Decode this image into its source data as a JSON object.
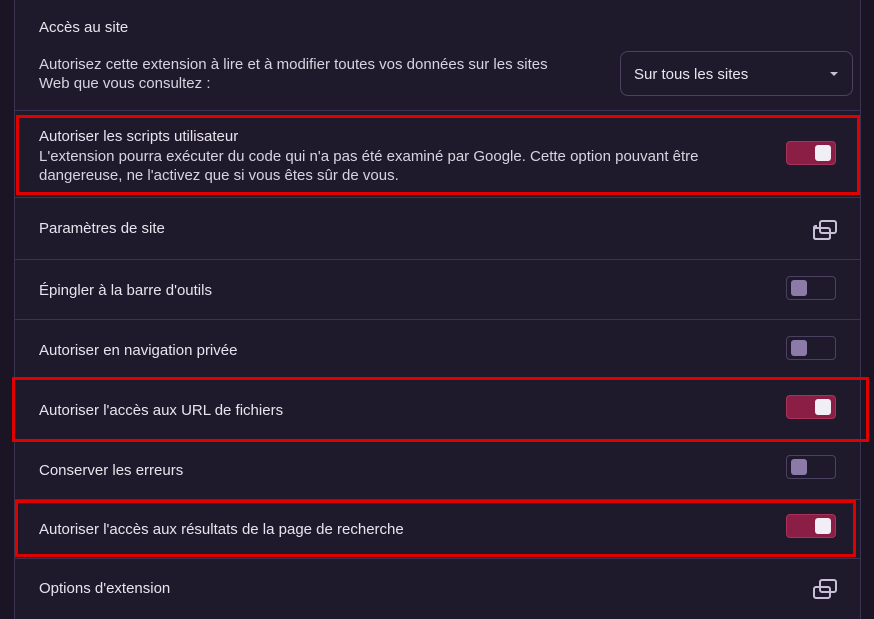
{
  "site_access": {
    "heading": "Accès au site",
    "description_line1": "Autorisez cette extension à lire et à modifier toutes vos données sur les sites",
    "description_line2": "Web que vous consultez :",
    "select_value": "Sur tous les sites"
  },
  "user_scripts": {
    "label": "Autoriser les scripts utilisateur",
    "description_line1": "L'extension pourra exécuter du code qui n'a pas été examiné par Google. Cette option pouvant être",
    "description_line2": "dangereuse, ne l'activez que si vous êtes sûr de vous.",
    "enabled": true
  },
  "site_settings": {
    "label": "Paramètres de site",
    "icon": "open-in-new-window-icon"
  },
  "pin_toolbar": {
    "label": "Épingler à la barre d'outils",
    "enabled": false
  },
  "incognito": {
    "label": "Autoriser en navigation privée",
    "enabled": false
  },
  "file_urls": {
    "label": "Autoriser l'accès aux URL de fichiers",
    "enabled": true
  },
  "collect_errors": {
    "label": "Conserver les erreurs",
    "enabled": false
  },
  "search_results": {
    "label": "Autoriser l'accès aux résultats de la page de recherche",
    "enabled": true
  },
  "extension_options": {
    "label": "Options d'extension",
    "icon": "open-in-new-window-icon"
  },
  "colors": {
    "background": "#1f1a2b",
    "toggle_on": "#8a1e44",
    "toggle_off_knob": "#8c7aa8",
    "highlight": "#e00000"
  }
}
